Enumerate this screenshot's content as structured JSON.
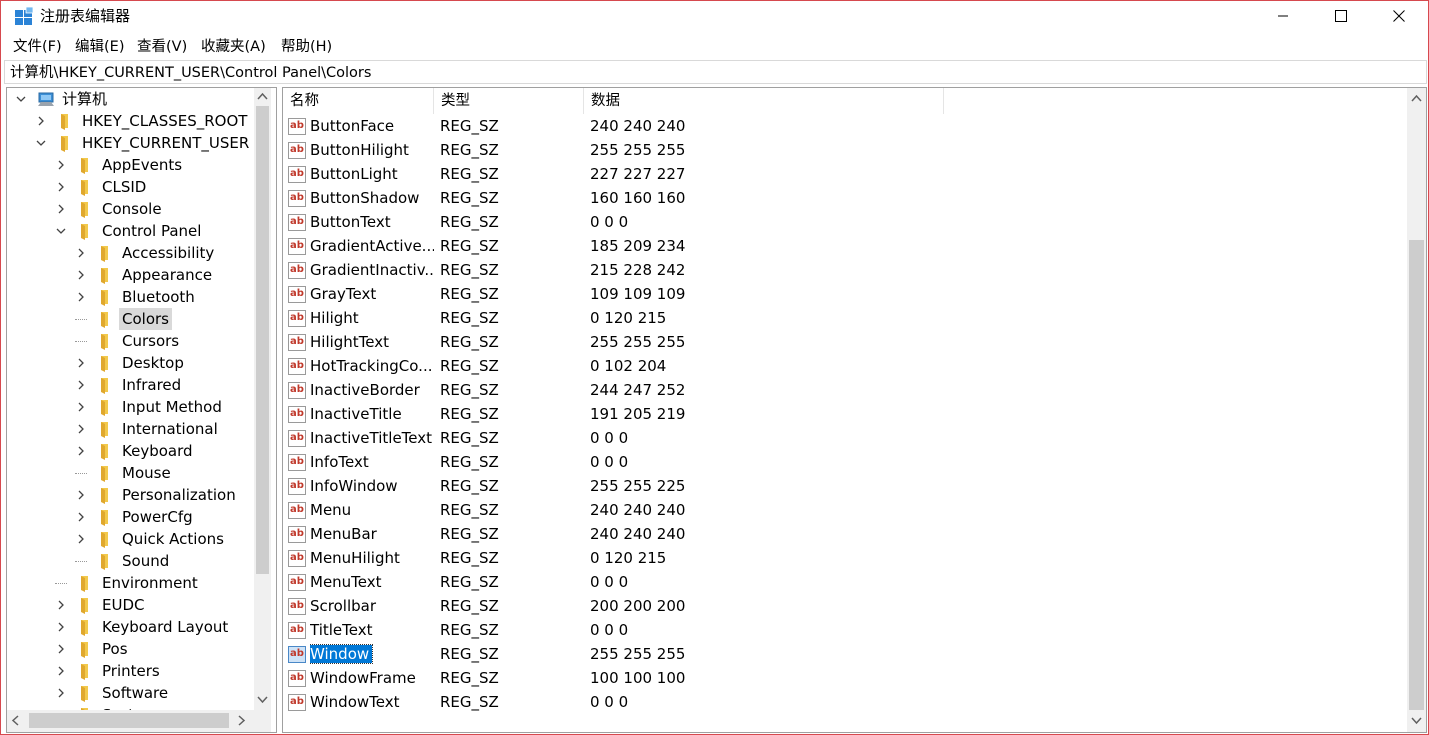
{
  "window": {
    "title": "注册表编辑器",
    "minimize_label": "",
    "maximize_label": "",
    "close_label": ""
  },
  "menu": [
    {
      "label": "文件(F)"
    },
    {
      "label": "编辑(E)"
    },
    {
      "label": "查看(V)"
    },
    {
      "label": "收藏夹(A)"
    },
    {
      "label": "帮助(H)"
    }
  ],
  "address": {
    "path": "计算机\\HKEY_CURRENT_USER\\Control Panel\\Colors"
  },
  "tree": {
    "items": [
      {
        "label": "计算机",
        "expanded": true,
        "icon": "computer-icon"
      },
      {
        "label": "HKEY_CLASSES_ROOT",
        "expanded": false,
        "icon": "folder-icon"
      },
      {
        "label": "HKEY_CURRENT_USER",
        "expanded": true,
        "icon": "folder-icon"
      },
      {
        "label": "AppEvents",
        "expanded": false,
        "icon": "folder-icon"
      },
      {
        "label": "CLSID",
        "expanded": false,
        "icon": "folder-icon"
      },
      {
        "label": "Console",
        "expanded": false,
        "icon": "folder-icon"
      },
      {
        "label": "Control Panel",
        "expanded": true,
        "icon": "folder-icon"
      },
      {
        "label": "Accessibility",
        "expanded": false,
        "icon": "folder-icon"
      },
      {
        "label": "Appearance",
        "expanded": false,
        "icon": "folder-icon"
      },
      {
        "label": "Bluetooth",
        "expanded": false,
        "icon": "folder-icon"
      },
      {
        "label": "Colors",
        "expanded": false,
        "icon": "folder-icon",
        "selected": true
      },
      {
        "label": "Cursors",
        "expanded": false,
        "icon": "folder-icon"
      },
      {
        "label": "Desktop",
        "expanded": false,
        "icon": "folder-icon"
      },
      {
        "label": "Infrared",
        "expanded": false,
        "icon": "folder-icon"
      },
      {
        "label": "Input Method",
        "expanded": false,
        "icon": "folder-icon"
      },
      {
        "label": "International",
        "expanded": false,
        "icon": "folder-icon"
      },
      {
        "label": "Keyboard",
        "expanded": false,
        "icon": "folder-icon"
      },
      {
        "label": "Mouse",
        "expanded": false,
        "icon": "folder-icon"
      },
      {
        "label": "Personalization",
        "expanded": false,
        "icon": "folder-icon"
      },
      {
        "label": "PowerCfg",
        "expanded": false,
        "icon": "folder-icon"
      },
      {
        "label": "Quick Actions",
        "expanded": false,
        "icon": "folder-icon"
      },
      {
        "label": "Sound",
        "expanded": false,
        "icon": "folder-icon"
      },
      {
        "label": "Environment",
        "expanded": false,
        "icon": "folder-icon"
      },
      {
        "label": "EUDC",
        "expanded": false,
        "icon": "folder-icon"
      },
      {
        "label": "Keyboard Layout",
        "expanded": false,
        "icon": "folder-icon"
      },
      {
        "label": "Pos",
        "expanded": false,
        "icon": "folder-icon"
      },
      {
        "label": "Printers",
        "expanded": false,
        "icon": "folder-icon"
      },
      {
        "label": "Software",
        "expanded": false,
        "icon": "folder-icon"
      },
      {
        "label": "System",
        "expanded": false,
        "icon": "folder-icon"
      }
    ]
  },
  "list": {
    "columns": [
      "名称",
      "类型",
      "数据"
    ],
    "rows": [
      {
        "name": "ButtonFace",
        "type": "REG_SZ",
        "data": "240 240 240"
      },
      {
        "name": "ButtonHilight",
        "type": "REG_SZ",
        "data": "255 255 255"
      },
      {
        "name": "ButtonLight",
        "type": "REG_SZ",
        "data": "227 227 227"
      },
      {
        "name": "ButtonShadow",
        "type": "REG_SZ",
        "data": "160 160 160"
      },
      {
        "name": "ButtonText",
        "type": "REG_SZ",
        "data": "0 0 0"
      },
      {
        "name": "GradientActive...",
        "type": "REG_SZ",
        "data": "185 209 234"
      },
      {
        "name": "GradientInactiv...",
        "type": "REG_SZ",
        "data": "215 228 242"
      },
      {
        "name": "GrayText",
        "type": "REG_SZ",
        "data": "109 109 109"
      },
      {
        "name": "Hilight",
        "type": "REG_SZ",
        "data": "0 120 215"
      },
      {
        "name": "HilightText",
        "type": "REG_SZ",
        "data": "255 255 255"
      },
      {
        "name": "HotTrackingCo...",
        "type": "REG_SZ",
        "data": "0 102 204"
      },
      {
        "name": "InactiveBorder",
        "type": "REG_SZ",
        "data": "244 247 252"
      },
      {
        "name": "InactiveTitle",
        "type": "REG_SZ",
        "data": "191 205 219"
      },
      {
        "name": "InactiveTitleText",
        "type": "REG_SZ",
        "data": "0 0 0"
      },
      {
        "name": "InfoText",
        "type": "REG_SZ",
        "data": "0 0 0"
      },
      {
        "name": "InfoWindow",
        "type": "REG_SZ",
        "data": "255 255 225"
      },
      {
        "name": "Menu",
        "type": "REG_SZ",
        "data": "240 240 240"
      },
      {
        "name": "MenuBar",
        "type": "REG_SZ",
        "data": "240 240 240"
      },
      {
        "name": "MenuHilight",
        "type": "REG_SZ",
        "data": "0 120 215"
      },
      {
        "name": "MenuText",
        "type": "REG_SZ",
        "data": "0 0 0"
      },
      {
        "name": "Scrollbar",
        "type": "REG_SZ",
        "data": "200 200 200"
      },
      {
        "name": "TitleText",
        "type": "REG_SZ",
        "data": "0 0 0"
      },
      {
        "name": "Window",
        "type": "REG_SZ",
        "data": "255 255 255",
        "selected": true
      },
      {
        "name": "WindowFrame",
        "type": "REG_SZ",
        "data": "100 100 100"
      },
      {
        "name": "WindowText",
        "type": "REG_SZ",
        "data": "0 0 0"
      }
    ]
  },
  "colors": {
    "selection": "#0078d7",
    "tree_selection": "#d9d9d9",
    "window_border": "#d6494e",
    "scroll_track": "#f0f0f0",
    "scroll_thumb": "#cdcdcd"
  }
}
